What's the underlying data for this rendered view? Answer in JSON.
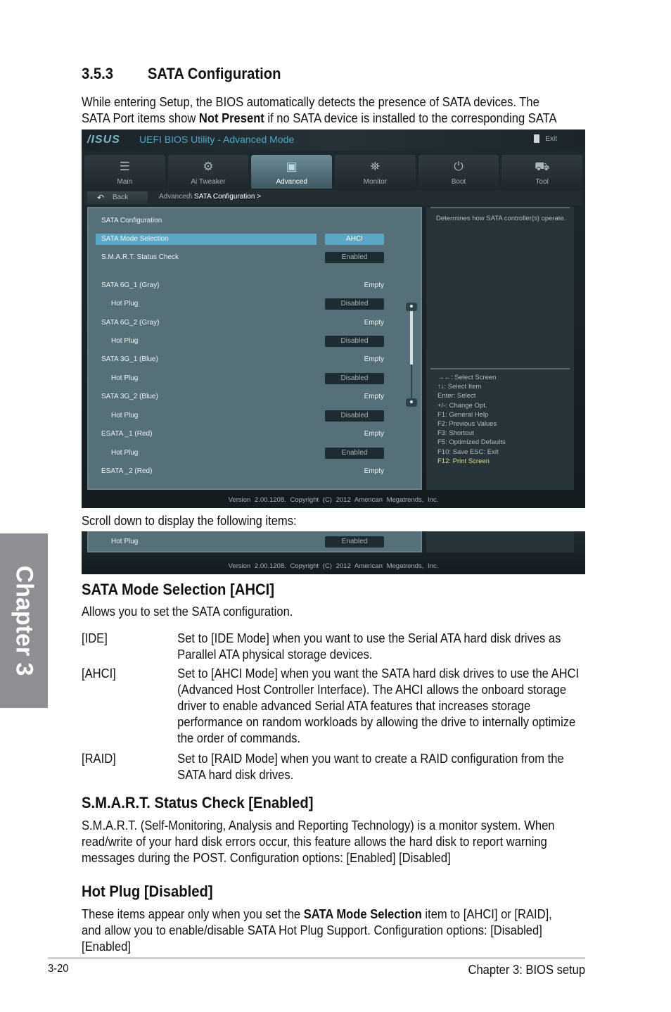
{
  "chapter_tab": "Chapter 3",
  "section": {
    "number": "3.5.3",
    "title": "SATA Configuration"
  },
  "intro": {
    "before": "While entering Setup, the BIOS automatically detects the presence of SATA devices. The SATA Port items show ",
    "bold": "Not Present",
    "after": " if no SATA device is installed to the corresponding SATA port."
  },
  "bios": {
    "logo": "/ISUS",
    "title": "UEFI BIOS Utility - Advanced Mode",
    "exit_label": "Exit",
    "tabs": [
      {
        "label": "Main",
        "icon": "list-icon",
        "glyph": "☰"
      },
      {
        "label": "Ai  Tweaker",
        "icon": "tweaker-icon",
        "glyph": "⚙"
      },
      {
        "label": "Advanced",
        "icon": "advanced-icon",
        "glyph": "▣"
      },
      {
        "label": "Monitor",
        "icon": "monitor-icon",
        "glyph": "⛯"
      },
      {
        "label": "Boot",
        "icon": "power-icon",
        "glyph": "⏻"
      },
      {
        "label": "Tool",
        "icon": "toolbox-icon",
        "glyph": "⛟"
      }
    ],
    "active_tab": "Advanced",
    "back_label": "Back",
    "breadcrumb_parent": "Advanced\\",
    "breadcrumb_current": "SATA Configuration  >",
    "panel_title": "SATA Configuration",
    "rows": [
      {
        "label": "SATA Mode Selection",
        "value": "AHCI"
      },
      {
        "label": "S.M.A.R.T. Status Check",
        "value": "Enabled"
      },
      {
        "label": "SATA 6G_1 (Gray)",
        "value": "Empty"
      },
      {
        "label": "Hot Plug",
        "value": "Disabled"
      },
      {
        "label": "SATA 6G_2 (Gray)",
        "value": "Empty"
      },
      {
        "label": "Hot Plug",
        "value": "Disabled"
      },
      {
        "label": "SATA 3G_1 (Blue)",
        "value": "Empty"
      },
      {
        "label": "Hot Plug",
        "value": "Disabled"
      },
      {
        "label": "SATA 3G_2 (Blue)",
        "value": "Empty"
      },
      {
        "label": "Hot Plug",
        "value": "Disabled"
      },
      {
        "label": "ESATA _1 (Red)",
        "value": "Empty"
      },
      {
        "label": "Hot Plug",
        "value": "Enabled"
      },
      {
        "label": "ESATA _2 (Red)",
        "value": "Empty"
      }
    ],
    "help_text": "Determines how SATA controller(s) operate.",
    "keys": [
      "→←:  Select Screen",
      "↑↓:  Select Item",
      "Enter:  Select",
      "+/-:  Change Opt.",
      "F1:  General Help",
      "F2:  Previous Values",
      "F3:  Shortcut",
      "F5:  Optimized Defaults",
      "F10:  Save    ESC:  Exit",
      "F12: Print Screen"
    ],
    "footer": "Version 2.00.1208. Copyright (C) 2012 American Megatrends, Inc.",
    "colors": {
      "highlight": "#5aa8c6",
      "title": "#4fa6c6",
      "f12": "#e6db80"
    }
  },
  "scroll_note": "Scroll down to display the following items:",
  "bios2": {
    "row": {
      "label": "Hot Plug",
      "value": "Enabled"
    },
    "footer": "Version 2.00.1208. Copyright (C) 2012 American Megatrends, Inc."
  },
  "sata_mode": {
    "heading": "SATA Mode Selection [AHCI]",
    "intro": "Allows you to set the SATA configuration.",
    "options": [
      {
        "key": "[IDE]",
        "desc": "Set to [IDE Mode] when you want to use the Serial ATA hard disk drives as Parallel ATA physical storage devices."
      },
      {
        "key": "[AHCI]",
        "desc": "Set to [AHCI Mode] when you want the SATA hard disk drives to use the AHCI (Advanced Host Controller Interface). The AHCI allows the onboard storage driver to enable advanced Serial ATA features that increases storage performance on random workloads by allowing the drive to internally optimize the order of commands."
      },
      {
        "key": "[RAID]",
        "desc": "Set to [RAID Mode] when you want to create a RAID configuration from the SATA hard disk drives."
      }
    ]
  },
  "smart": {
    "heading": "S.M.A.R.T. Status Check [Enabled]",
    "body": "S.M.A.R.T. (Self-Monitoring, Analysis and Reporting Technology) is a monitor system. When read/write of your hard disk errors occur, this feature allows the hard disk to report warning messages during the POST. Configuration options: [Enabled] [Disabled]"
  },
  "hotplug": {
    "heading": "Hot Plug [Disabled]",
    "before": "These items appear only when you set the ",
    "bold": "SATA Mode Selection",
    "after": " item to [AHCI] or [RAID], and allow you to enable/disable SATA Hot Plug Support. Configuration options: [Disabled] [Enabled]"
  },
  "footer": {
    "page": "3-20",
    "chapter": "Chapter 3: BIOS setup"
  }
}
